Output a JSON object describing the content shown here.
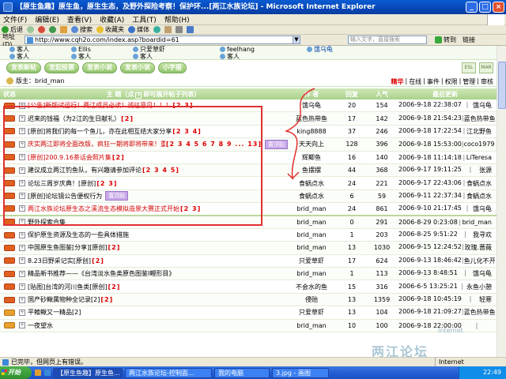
{
  "window": {
    "title": "【原生鱼趣】原生鱼，原生生态，及野外探险考察！保护环...[两江水族论坛] - Microsoft Internet Explorer",
    "buttons": [
      "_",
      "□",
      "×"
    ]
  },
  "menu": [
    "文件(F)",
    "编辑(E)",
    "查看(V)",
    "收藏(A)",
    "工具(T)",
    "帮助(H)"
  ],
  "toolbar": [
    "后退",
    "→",
    "✕",
    "⟳",
    "⌂",
    "搜索",
    "收藏夹",
    "媒体",
    "历史",
    "邮件",
    "打印",
    "编辑"
  ],
  "address": {
    "label": "地址(D)",
    "url": "http://www.cqh2o.com/index.asp?boardid=61",
    "search_placeholder": "输入文字，直接搜索",
    "go_label": "转到",
    "links_label": "链接"
  },
  "online_users": {
    "row1": [
      "客人",
      "Ellis",
      "只爱草虾",
      "feelhang",
      "饿乌龟"
    ],
    "row2": [
      "客人",
      "客人",
      "客人",
      "客人"
    ]
  },
  "actions": {
    "buttons": [
      "发表新帖",
      "发起投票",
      "发表小说",
      "发表小说",
      "小字报"
    ],
    "small": [
      "ESL",
      "MAR"
    ]
  },
  "moderator": {
    "label": "版主：brid_man",
    "links": [
      "精华",
      "在线",
      "事件",
      "权限",
      "管理",
      "审核"
    ]
  },
  "table_header": {
    "state": "状态",
    "topic": "主 题（点",
    "topic_hint": "即可展开帖子列表）",
    "author": "作 者",
    "reply": "回复",
    "hits": "人气",
    "last": "最后更新"
  },
  "topics": [
    {
      "title": "[公告]新版试运行！两江成员必读！诚征意见！！！",
      "red": true,
      "pages": "[2 3]",
      "author": "饿乌龟",
      "reply": "20",
      "hits": "154",
      "date": "2006-9-18 22:38:07",
      "last": "饿乌龟",
      "pin": ""
    },
    {
      "title": "迟来的钱福（为2江的生日献礼）",
      "red": false,
      "pages": "[2]",
      "author": "蓝色热带鱼",
      "reply": "17",
      "hits": "142",
      "date": "2006-9-18 21:54:23",
      "last": "蓝色热带鱼",
      "pin": ""
    },
    {
      "title": "[原创]将我们的每一个鱼儿，亦在此相互结大家分享",
      "red": false,
      "pages": "[2 3 4]",
      "author": "king8888",
      "reply": "37",
      "hits": "246",
      "date": "2006-9-18 17:22:54",
      "last": "江北野鱼",
      "pin": ""
    },
    {
      "title": "庆实两江即将全面改版，疯狂一期将即将带来！重新开始欢迎！",
      "red": true,
      "pages": "[2 3 4 5 6 7 8 9 ... 13]",
      "author": "天天向上",
      "reply": "128",
      "hits": "396",
      "date": "2006-9-18 15:53:00",
      "last": "coco1979",
      "pin": "置顶贴"
    },
    {
      "title": "[原创]200.9.16茶话会照片集",
      "red": true,
      "pages": "[2]",
      "author": "辉鲫鱼",
      "reply": "16",
      "hits": "140",
      "date": "2006-9-18 11:14:18",
      "last": "LiTeresa",
      "pin": ""
    },
    {
      "title": "建议成立两江钓鱼队，有兴趣请参加评论",
      "red": false,
      "pages": "[2 3 4 5]",
      "author": "鱼摆摆",
      "reply": "44",
      "hits": "368",
      "date": "2006-9-17 19:11:25",
      "last": "张源",
      "pin": ""
    },
    {
      "title": "论坛三周岁庆典！[原创]",
      "red": false,
      "pages": "[2 3]",
      "author": "食蜗点水",
      "reply": "24",
      "hits": "221",
      "date": "2006-9-17 22:43:06",
      "last": "食蜗点水",
      "pin": ""
    },
    {
      "title": "[原创]论坛镜公告便权行为",
      "red": false,
      "pages": "",
      "author": "食蜗点水",
      "reply": "6",
      "hits": "59",
      "date": "2006-9-11 22:37:34",
      "last": "食蜗点水",
      "pin": "置顶贴"
    },
    {
      "title": "两江水族论坛原生态之溪流生态模拟造景大赛正式开始",
      "red": true,
      "pages": "[2 3]",
      "author": "brid_man",
      "reply": "24",
      "hits": "861",
      "date": "2006-9-10 21:17:45",
      "last": "饿乌龟",
      "pin": ""
    },
    {
      "title": "野外探索合集",
      "red": false,
      "pages": "",
      "author": "brid_man",
      "reply": "0",
      "hits": "291",
      "date": "2006-8-29 0:23:08",
      "last": "brid_man",
      "pin": ""
    },
    {
      "title": "保护原生资源及生态的一些具体措施",
      "red": false,
      "pages": "",
      "author": "brid_man",
      "reply": "1",
      "hits": "203",
      "date": "2006-8-25 9:51:22",
      "last": "我寻欢",
      "pin": ""
    },
    {
      "title": "中国原生鱼图鉴[分享][原创]",
      "red": false,
      "pages": "[2]",
      "author": "brid_man",
      "reply": "13",
      "hits": "1030",
      "date": "2006-9-15 12:24:52",
      "last": "玫瑰.蔷薇",
      "pin": ""
    },
    {
      "title": "8.23日野采记实[原创]",
      "red": false,
      "pages": "[2]",
      "author": "只爱草虾",
      "reply": "17",
      "hits": "624",
      "date": "2006-9-13 18:46:42",
      "last": "鱼儿化不开",
      "pin": ""
    },
    {
      "title": "精品新书推荐——《台湾淡水鱼类原色图鉴Ⅰ鲤形目》",
      "red": false,
      "pages": "",
      "author": "brid_man",
      "reply": "1",
      "hits": "113",
      "date": "2006-9-13 8:48:51",
      "last": "饿乌龟",
      "pin": ""
    },
    {
      "title": "[贴图]台湾的河川鱼类[原创]",
      "red": false,
      "pages": "[2]",
      "author": "不会水的鱼",
      "reply": "15",
      "hits": "316",
      "date": "2006-6-5 13:25:21",
      "last": "永鱼小憩",
      "pin": ""
    },
    {
      "title": "国产砂鳅属物种全记录[2]",
      "red": false,
      "pages": "[2]",
      "author": "侵贻",
      "reply": "13",
      "hits": "1359",
      "date": "2006-9-18 10:45:19",
      "last": "轻寒",
      "pin": ""
    },
    {
      "title": "平鳍鳅又一精品[2]",
      "red": false,
      "pages": "",
      "author": "只爱草虾",
      "reply": "13",
      "hits": "104",
      "date": "2006-9-18 21:09:27",
      "last": "蓝色热带鱼",
      "pin": ""
    },
    {
      "title": "一夜望水",
      "red": false,
      "pages": "",
      "author": "brid_man",
      "reply": "10",
      "hits": "100",
      "date": "2006-9-18 22:00:00",
      "last": "",
      "pin": ""
    }
  ],
  "status": {
    "text": "已完毕，但网页上有错误。",
    "zone": "Internet"
  },
  "taskbar": {
    "start": "开始",
    "tasks": [
      "【原生鱼趣】原生鱼...",
      "两江水族论坛-控制面...",
      "我的电脑",
      "3.jpg - 画图"
    ],
    "clock": "22:49"
  },
  "watermark": {
    "text": "两江论坛",
    "url": "www.cqh2o.com",
    "sub": "Internet"
  }
}
